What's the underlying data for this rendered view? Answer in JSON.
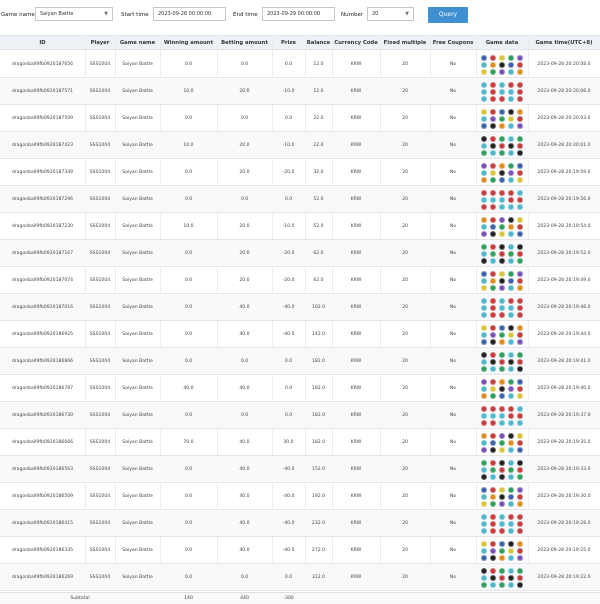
{
  "filters": {
    "game_name_label": "Game name",
    "game_name_value": "Saiyan Battle",
    "start_time_label": "Start time",
    "start_time_value": "2023-09-28 00:00:00",
    "end_time_label": "End time",
    "end_time_value": "2023-09-29 00:00:00",
    "number_label": "Number",
    "number_value": "20",
    "query_label": "Query"
  },
  "columns": [
    "ID",
    "Player",
    "Game name",
    "Winning amount",
    "Betting amount",
    "Prize",
    "Balance",
    "Currency Code",
    "Fixed multiple",
    "Free Coupons",
    "Game data",
    "Game time(UTC+8)"
  ],
  "rows": [
    {
      "id": "dragonball9fb0920187656",
      "player": "SSS1004",
      "game": "Saiyan Battle",
      "win": "0.0",
      "bet": "0.0",
      "prize": "0.0",
      "balance": "12.0",
      "currency": "KRW",
      "multiple": "20",
      "coupons": "No",
      "time": "2023-09-28 20:20:08.0"
    },
    {
      "id": "dragonball9fb0920187571",
      "player": "SSS1004",
      "game": "Saiyan Battle",
      "win": "10.0",
      "bet": "20.0",
      "prize": "-10.0",
      "balance": "12.0",
      "currency": "KRW",
      "multiple": "20",
      "coupons": "No",
      "time": "2023-09-28 20:20:06.0"
    },
    {
      "id": "dragonball9fb0920187509",
      "player": "SSS1004",
      "game": "Saiyan Battle",
      "win": "0.0",
      "bet": "0.0",
      "prize": "0.0",
      "balance": "22.0",
      "currency": "KRW",
      "multiple": "20",
      "coupons": "No",
      "time": "2023-09-28 20:20:03.0"
    },
    {
      "id": "dragonball9fb0920187423",
      "player": "SSS1004",
      "game": "Saiyan Battle",
      "win": "10.0",
      "bet": "20.0",
      "prize": "-10.0",
      "balance": "22.0",
      "currency": "KRW",
      "multiple": "20",
      "coupons": "No",
      "time": "2023-09-28 20:20:01.0"
    },
    {
      "id": "dragonball9fb0920187349",
      "player": "SSS1004",
      "game": "Saiyan Battle",
      "win": "0.0",
      "bet": "20.0",
      "prize": "-20.0",
      "balance": "32.0",
      "currency": "KRW",
      "multiple": "20",
      "coupons": "No",
      "time": "2023-09-28 20:19:59.0"
    },
    {
      "id": "dragonball9fb0920187296",
      "player": "SSS1004",
      "game": "Saiyan Battle",
      "win": "0.0",
      "bet": "0.0",
      "prize": "0.0",
      "balance": "52.0",
      "currency": "KRW",
      "multiple": "20",
      "coupons": "No",
      "time": "2023-09-28 20:19:56.0"
    },
    {
      "id": "dragonball9fb0920187230",
      "player": "SSS1004",
      "game": "Saiyan Battle",
      "win": "10.0",
      "bet": "20.0",
      "prize": "-10.0",
      "balance": "52.0",
      "currency": "KRW",
      "multiple": "20",
      "coupons": "No",
      "time": "2023-09-28 20:19:54.0"
    },
    {
      "id": "dragonball9fb0920187167",
      "player": "SSS1004",
      "game": "Saiyan Battle",
      "win": "0.0",
      "bet": "20.0",
      "prize": "-20.0",
      "balance": "62.0",
      "currency": "KRW",
      "multiple": "20",
      "coupons": "No",
      "time": "2023-09-28 20:19:52.0"
    },
    {
      "id": "dragonball9fb0920187074",
      "player": "SSS1004",
      "game": "Saiyan Battle",
      "win": "0.0",
      "bet": "20.0",
      "prize": "-20.0",
      "balance": "62.0",
      "currency": "KRW",
      "multiple": "20",
      "coupons": "No",
      "time": "2023-09-28 20:19:49.0"
    },
    {
      "id": "dragonball9fb0920187016",
      "player": "SSS1004",
      "game": "Saiyan Battle",
      "win": "0.0",
      "bet": "40.0",
      "prize": "-40.0",
      "balance": "102.0",
      "currency": "KRW",
      "multiple": "20",
      "coupons": "No",
      "time": "2023-09-28 20:19:46.0"
    },
    {
      "id": "dragonball9fb0920186925",
      "player": "SSS1004",
      "game": "Saiyan Battle",
      "win": "0.0",
      "bet": "40.0",
      "prize": "-40.0",
      "balance": "142.0",
      "currency": "KRW",
      "multiple": "20",
      "coupons": "No",
      "time": "2023-09-28 20:19:44.0"
    },
    {
      "id": "dragonball9fb0920186866",
      "player": "SSS1004",
      "game": "Saiyan Battle",
      "win": "0.0",
      "bet": "0.0",
      "prize": "0.0",
      "balance": "182.0",
      "currency": "KRW",
      "multiple": "20",
      "coupons": "No",
      "time": "2023-09-28 20:19:41.0"
    },
    {
      "id": "dragonball9fb0920186787",
      "player": "SSS1004",
      "game": "Saiyan Battle",
      "win": "40.0",
      "bet": "40.0",
      "prize": "0.0",
      "balance": "182.0",
      "currency": "KRW",
      "multiple": "20",
      "coupons": "No",
      "time": "2023-09-28 20:19:40.0"
    },
    {
      "id": "dragonball9fb0920186730",
      "player": "SSS1004",
      "game": "Saiyan Battle",
      "win": "0.0",
      "bet": "0.0",
      "prize": "0.0",
      "balance": "182.0",
      "currency": "KRW",
      "multiple": "20",
      "coupons": "No",
      "time": "2023-09-28 20:19:37.0"
    },
    {
      "id": "dragonball9fb0920186666",
      "player": "SSS1004",
      "game": "Saiyan Battle",
      "win": "70.0",
      "bet": "40.0",
      "prize": "30.0",
      "balance": "182.0",
      "currency": "KRW",
      "multiple": "20",
      "coupons": "No",
      "time": "2023-09-28 20:19:35.0"
    },
    {
      "id": "dragonball9fb0920186563",
      "player": "SSS1004",
      "game": "Saiyan Battle",
      "win": "0.0",
      "bet": "40.0",
      "prize": "-40.0",
      "balance": "152.0",
      "currency": "KRW",
      "multiple": "20",
      "coupons": "No",
      "time": "2023-09-28 20:19:33.0"
    },
    {
      "id": "dragonball9fb0920186509",
      "player": "SSS1004",
      "game": "Saiyan Battle",
      "win": "0.0",
      "bet": "40.0",
      "prize": "-40.0",
      "balance": "192.0",
      "currency": "KRW",
      "multiple": "20",
      "coupons": "No",
      "time": "2023-09-28 20:19:30.0"
    },
    {
      "id": "dragonball9fb0920186415",
      "player": "SSS1004",
      "game": "Saiyan Battle",
      "win": "0.0",
      "bet": "40.0",
      "prize": "-40.0",
      "balance": "232.0",
      "currency": "KRW",
      "multiple": "20",
      "coupons": "No",
      "time": "2023-09-28 20:19:28.0"
    },
    {
      "id": "dragonball9fb0920186335",
      "player": "SSS1004",
      "game": "Saiyan Battle",
      "win": "0.0",
      "bet": "40.0",
      "prize": "-40.0",
      "balance": "272.0",
      "currency": "KRW",
      "multiple": "20",
      "coupons": "No",
      "time": "2023-09-28 20:19:25.0"
    },
    {
      "id": "dragonball9fb0920186269",
      "player": "SSS1004",
      "game": "Saiyan Battle",
      "win": "0.0",
      "bet": "0.0",
      "prize": "0.0",
      "balance": "312.0",
      "currency": "KRW",
      "multiple": "20",
      "coupons": "No",
      "time": "2023-09-28 20:19:22.0"
    }
  ],
  "subtotal": {
    "label": "Subtotal",
    "win": "140",
    "bet": "440",
    "prize": "-300"
  },
  "symbol_colors": [
    "#3b5fa8",
    "#2e9c5a",
    "#e08a1e",
    "#c23b3b",
    "#7a4fb5",
    "#1f1f1f",
    "#d9c23a",
    "#4bb6c9"
  ]
}
